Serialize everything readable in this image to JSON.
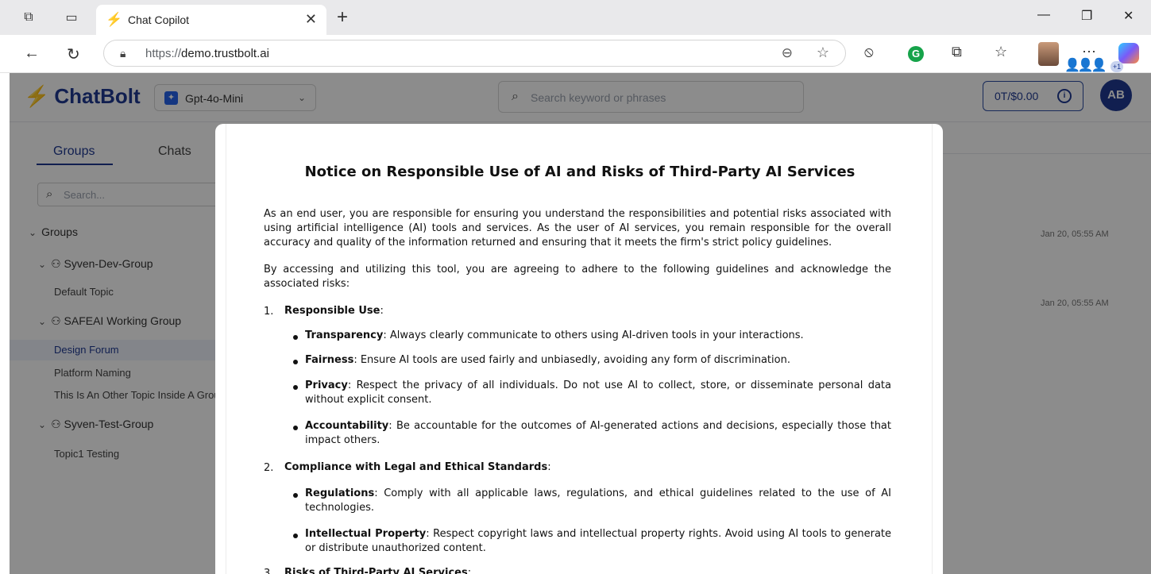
{
  "browser": {
    "tab_title": "Chat Copilot",
    "url_prefix": "https://",
    "url_domain": "demo.trustbolt.ai"
  },
  "app": {
    "logo": "ChatBolt",
    "model": "Gpt-4o-Mini",
    "search_placeholder": "Search keyword or phrases",
    "token_usage": "0T/$0.00",
    "user_initials": "AB",
    "members_more": "+1"
  },
  "sidebar": {
    "tab_groups": "Groups",
    "tab_chats": "Chats",
    "search_placeholder": "Search...",
    "groups_header": "Groups",
    "groups": [
      {
        "name": "Syven-Dev-Group",
        "topics": [
          "Default Topic"
        ]
      },
      {
        "name": "SAFEAI Working Group",
        "topics": [
          "Design Forum",
          "Platform Naming",
          "This Is An Other Topic Inside A Grou"
        ]
      },
      {
        "name": "Syven-Test-Group",
        "topics": [
          "Topic1 Testing"
        ]
      }
    ]
  },
  "timestamps": [
    "Jan 20, 05:55 AM",
    "Jan 20, 05:55 AM"
  ],
  "modal": {
    "title": "Notice on Responsible Use of AI and Risks of Third-Party AI Services",
    "intro_1": "As an end user, you are responsible for ensuring you understand the responsibilities and potential risks associated with using artificial intelligence (AI) tools and services. As the user of AI services, you remain responsible for the overall accuracy and quality of the information returned and ensuring that it meets the firm's strict policy guidelines.",
    "intro_2": "By accessing and utilizing this tool, you are agreeing to adhere to the following guidelines and acknowledge the associated risks:",
    "sections": [
      {
        "number": "1.",
        "heading": "Responsible Use",
        "items": [
          {
            "term": "Transparency",
            "text": "Always clearly communicate to others using AI-driven tools in your interactions."
          },
          {
            "term": "Fairness",
            "text": "Ensure AI tools are used fairly and unbiasedly, avoiding any form of discrimination."
          },
          {
            "term": "Privacy",
            "text": "Respect the privacy of all individuals. Do not use AI to collect, store, or disseminate personal data without explicit consent."
          },
          {
            "term": "Accountability",
            "text": "Be accountable for the outcomes of AI-generated actions and decisions, especially those that impact others."
          }
        ]
      },
      {
        "number": "2.",
        "heading": "Compliance with Legal and Ethical Standards",
        "items": [
          {
            "term": "Regulations",
            "text": "Comply with all applicable laws, regulations, and ethical guidelines related to the use of AI technologies."
          },
          {
            "term": "Intellectual Property",
            "text": "Respect copyright laws and intellectual property rights. Avoid using AI tools to generate or distribute unauthorized content."
          }
        ]
      },
      {
        "number": "3.",
        "heading": "Risks of Third-Party AI Services",
        "items": []
      }
    ]
  }
}
